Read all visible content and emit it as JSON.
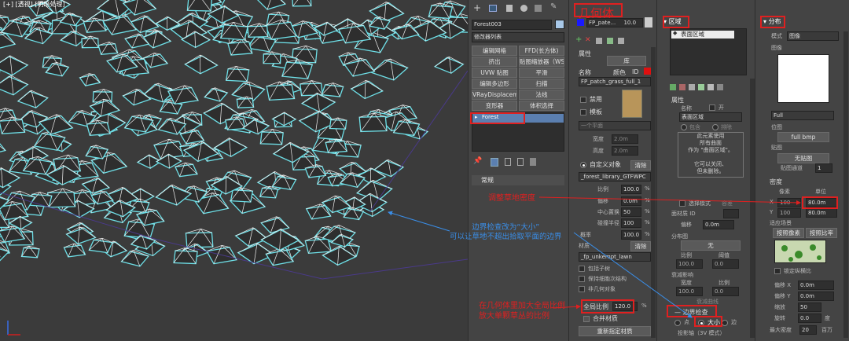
{
  "viewport": {
    "label": "[+] [透视] [明暗处理]"
  },
  "toolbar": {
    "icons": [
      "plus-icon",
      "modify-icon",
      "hierarchy-icon",
      "motion-icon",
      "display-icon",
      "utilities-icon"
    ]
  },
  "p1": {
    "object_name": "Forest003",
    "modifier_list": "修改器列表",
    "buttons": [
      "编辑网格",
      "FFD(长方体)",
      "挤出",
      "贴图缩放器（WSM",
      "UVW 贴图",
      "平滑",
      "编辑多边形",
      "扫描",
      "VRayDisplacemen",
      "法线",
      "变形器",
      "体积选择"
    ],
    "stack_item": "Forest",
    "rollout": "常规"
  },
  "p2": {
    "title": "几何体",
    "preset": "FP_pate...",
    "preset_value": "10.0",
    "section_props": "属性",
    "lib_button": "库",
    "name_label": "名称",
    "color_label": "颜色",
    "id_label": "ID",
    "name_value": "FP_patch_grass_full_1",
    "disable_label": "禁用",
    "template_label": "模板",
    "plane_dropdown": "一个平面",
    "width_label": "宽度",
    "width_value": "2.0m",
    "height_label": "高度",
    "height_value": "2.0m",
    "custom_label": "自定义对象",
    "clear_label": "清除",
    "library_value": "_forest_library_GTFWPC",
    "scale_label": "比例",
    "scale_value": "100.0",
    "offset_label": "偏移",
    "offset_value": "0.0m",
    "center_label": "中心置换",
    "center_value": "50",
    "radius_label": "碰撞半径",
    "radius_value": "100",
    "prob_label": "概率",
    "prob_value": "100.0",
    "material_label": "材质",
    "mat_clear": "清除",
    "mat_value": "_fp_unkempt_lawn",
    "cb1": "包括子树",
    "cb2": "保持细胞次结构",
    "cb3": "非几何对象",
    "global_scale_label": "全局比例",
    "global_scale_value": "120.0",
    "merge_label": "合并材质",
    "reset_button": "重新指定材质",
    "pct": "%"
  },
  "p3": {
    "title": "区域",
    "list_item": "表面区域",
    "section_props": "属性",
    "name_label": "名称",
    "on_label": "开",
    "name_value": "表面区域",
    "include_label": "包含",
    "exclude_label": "排除",
    "note": [
      "此元素使用",
      "所有曲面",
      "作为 \"曲面区域\"。",
      "",
      "它可以关闭、",
      "但未删除。"
    ],
    "select_mode": "选择模式",
    "tolerance": "容差",
    "face_id": "面材质 ID",
    "offset_label": "偏移",
    "offset_value": "0.0m",
    "dist_title": "分布图",
    "none_btn": "无",
    "ratio_label": "比例",
    "threshold_label": "阈值",
    "ratio_value": "100.0",
    "threshold_value": "0.0",
    "falloff_title": "衰减影响",
    "width_label": "宽度",
    "density_label": "比例",
    "fw_value": "100.0",
    "fd_value": "0.0",
    "falloff_curve": "衰减曲线",
    "boundary_title": "边界检查",
    "opt_point": "点",
    "opt_size": "大小",
    "opt_edge": "边",
    "project": "投影轴（3V 模式）"
  },
  "p4": {
    "title": "分布",
    "mode_label": "模式",
    "mode_value": "图像",
    "image_label": "图像",
    "full_dropdown": "Full",
    "bitmap_label": "位图",
    "bitmap_value": "full bmp",
    "map_label": "贴图",
    "map_none": "无贴图",
    "map_channel": "贴图通道",
    "map_channel_value": "1",
    "density_title": "密度",
    "pixel_label": "像素",
    "unit_label": "单位",
    "x_label": "X",
    "x_pixel": "100",
    "x_unit": "80.0m",
    "y_label": "Y",
    "y_pixel": "100",
    "y_unit": "80.0m",
    "adapt_label": "适应场景",
    "pixel_btn": "按照像素",
    "scale_btn": "按照比率",
    "lock_label": "锁定纵横比",
    "off1_label": "偏移 X",
    "off1_value": "0.0m",
    "off2_label": "偏移 Y",
    "off2_value": "0.0m",
    "scale_label": "缩放",
    "scale_value": "50",
    "rot_label": "旋转",
    "rot_value": "0.0",
    "rot_unit": "度",
    "max_label": "最大密度",
    "max_value": "20",
    "max_unit": "百万"
  },
  "annotations": {
    "red1": "调整草地密度",
    "blue1": [
      "边界检查改为“大小”",
      "可以让草地不超出拾取平面的边界"
    ],
    "red2": [
      "在几何体里加大全局比例",
      "放大单颗草丛的比例"
    ]
  }
}
